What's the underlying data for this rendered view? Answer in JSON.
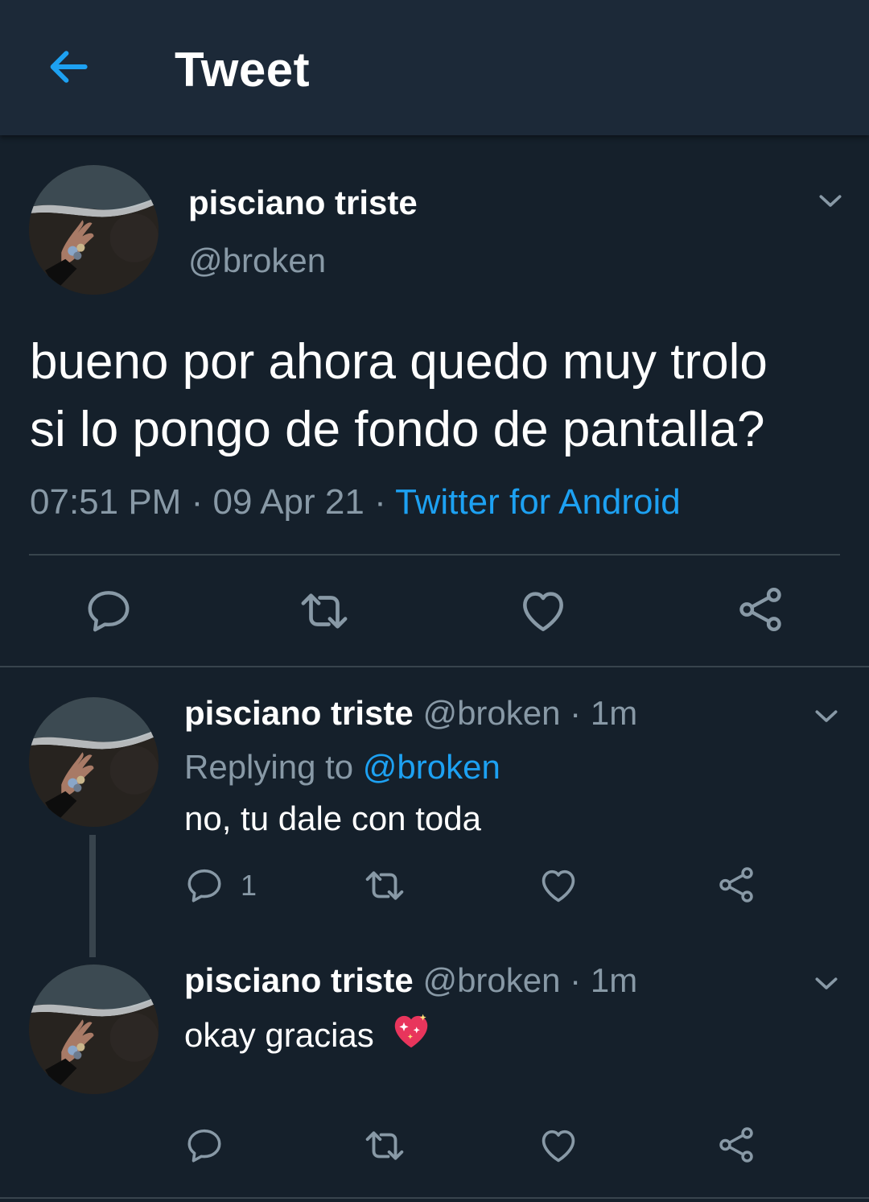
{
  "header": {
    "title": "Tweet"
  },
  "main_tweet": {
    "name": "pisciano triste",
    "handle": "@broken",
    "text_line1": "bueno por ahora quedo muy trolo",
    "text_line2": "si lo pongo de fondo de pantalla?",
    "time": "07:51 PM",
    "sep1": "·",
    "date": "09 Apr 21",
    "sep2": "·",
    "source": "Twitter for Android"
  },
  "replies": [
    {
      "name": "pisciano triste",
      "handle": "@broken",
      "sep": "·",
      "age": "1m",
      "replying_label": "Replying to",
      "replying_handle": "@broken",
      "text": "no, tu dale con toda",
      "reply_count": "1"
    },
    {
      "name": "pisciano triste",
      "handle": "@broken",
      "sep": "·",
      "age": "1m",
      "text": "okay gracias",
      "emoji": "💖"
    }
  ],
  "colors": {
    "background": "#15202b",
    "header": "#1c2938",
    "accent": "#1da1f2",
    "muted": "#8899a6",
    "divider": "#38444d"
  },
  "icons": [
    "back-arrow-icon",
    "chevron-down-icon",
    "reply-icon",
    "retweet-icon",
    "heart-icon",
    "share-icon",
    "sparkling-heart-emoji"
  ]
}
